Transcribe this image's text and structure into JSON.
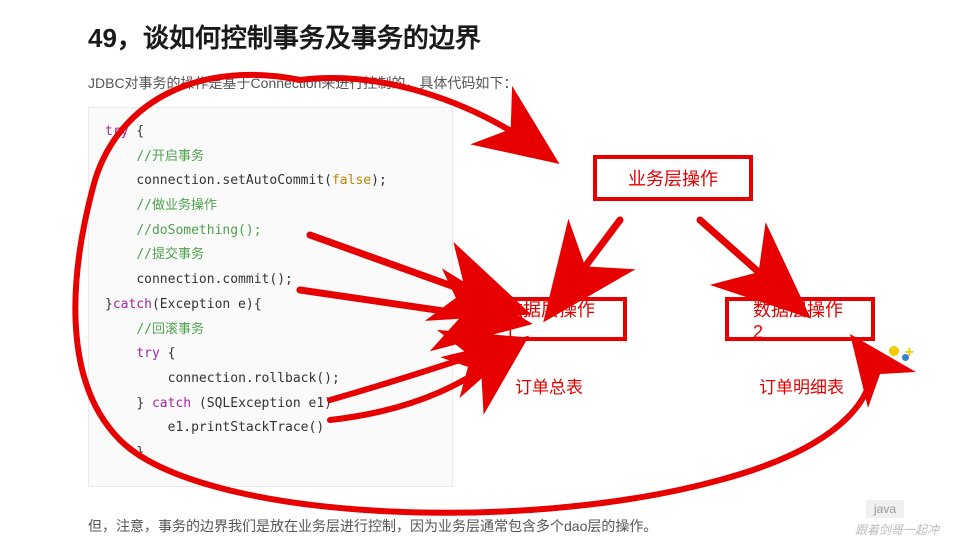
{
  "heading": "49，谈如何控制事务及事务的边界",
  "intro": "JDBC对事务的操作是基于Connection来进行控制的，具体代码如下：",
  "code": {
    "l1a": "try",
    "l1b": " {",
    "l2": "//开启事务",
    "l3a": "connection.",
    "l3b": "setAutoCommit",
    "l3c": "(",
    "l3d": "false",
    "l3e": ");",
    "l4": "//做业务操作",
    "l5": "//doSomething();",
    "l6": "//提交事务",
    "l7a": "connection.",
    "l7b": "commit",
    "l7c": "();",
    "l8a": "}",
    "l8b": "catch",
    "l8c": "(Exception e){",
    "l9": "//回滚事务",
    "l10a": "try",
    "l10b": " {",
    "l11a": "connection.",
    "l11b": "rollback",
    "l11c": "();",
    "l12a": "} ",
    "l12b": "catch",
    "l12c": " (SQLException e1)",
    "l13a": "e1.",
    "l13b": "printStackTrace",
    "l13c": "()",
    "l14": "}"
  },
  "diagram": {
    "box1": "业务层操作",
    "box2": "数据层操作1",
    "box3": "数据层操作2",
    "cap1": "订单总表",
    "cap2": "订单明细表"
  },
  "outro": "但，注意，事务的边界我们是放在业务层进行控制，因为业务层通常包含多个dao层的操作。",
  "lang_tag": "java",
  "watermark": "跟着剑哥一起冲"
}
